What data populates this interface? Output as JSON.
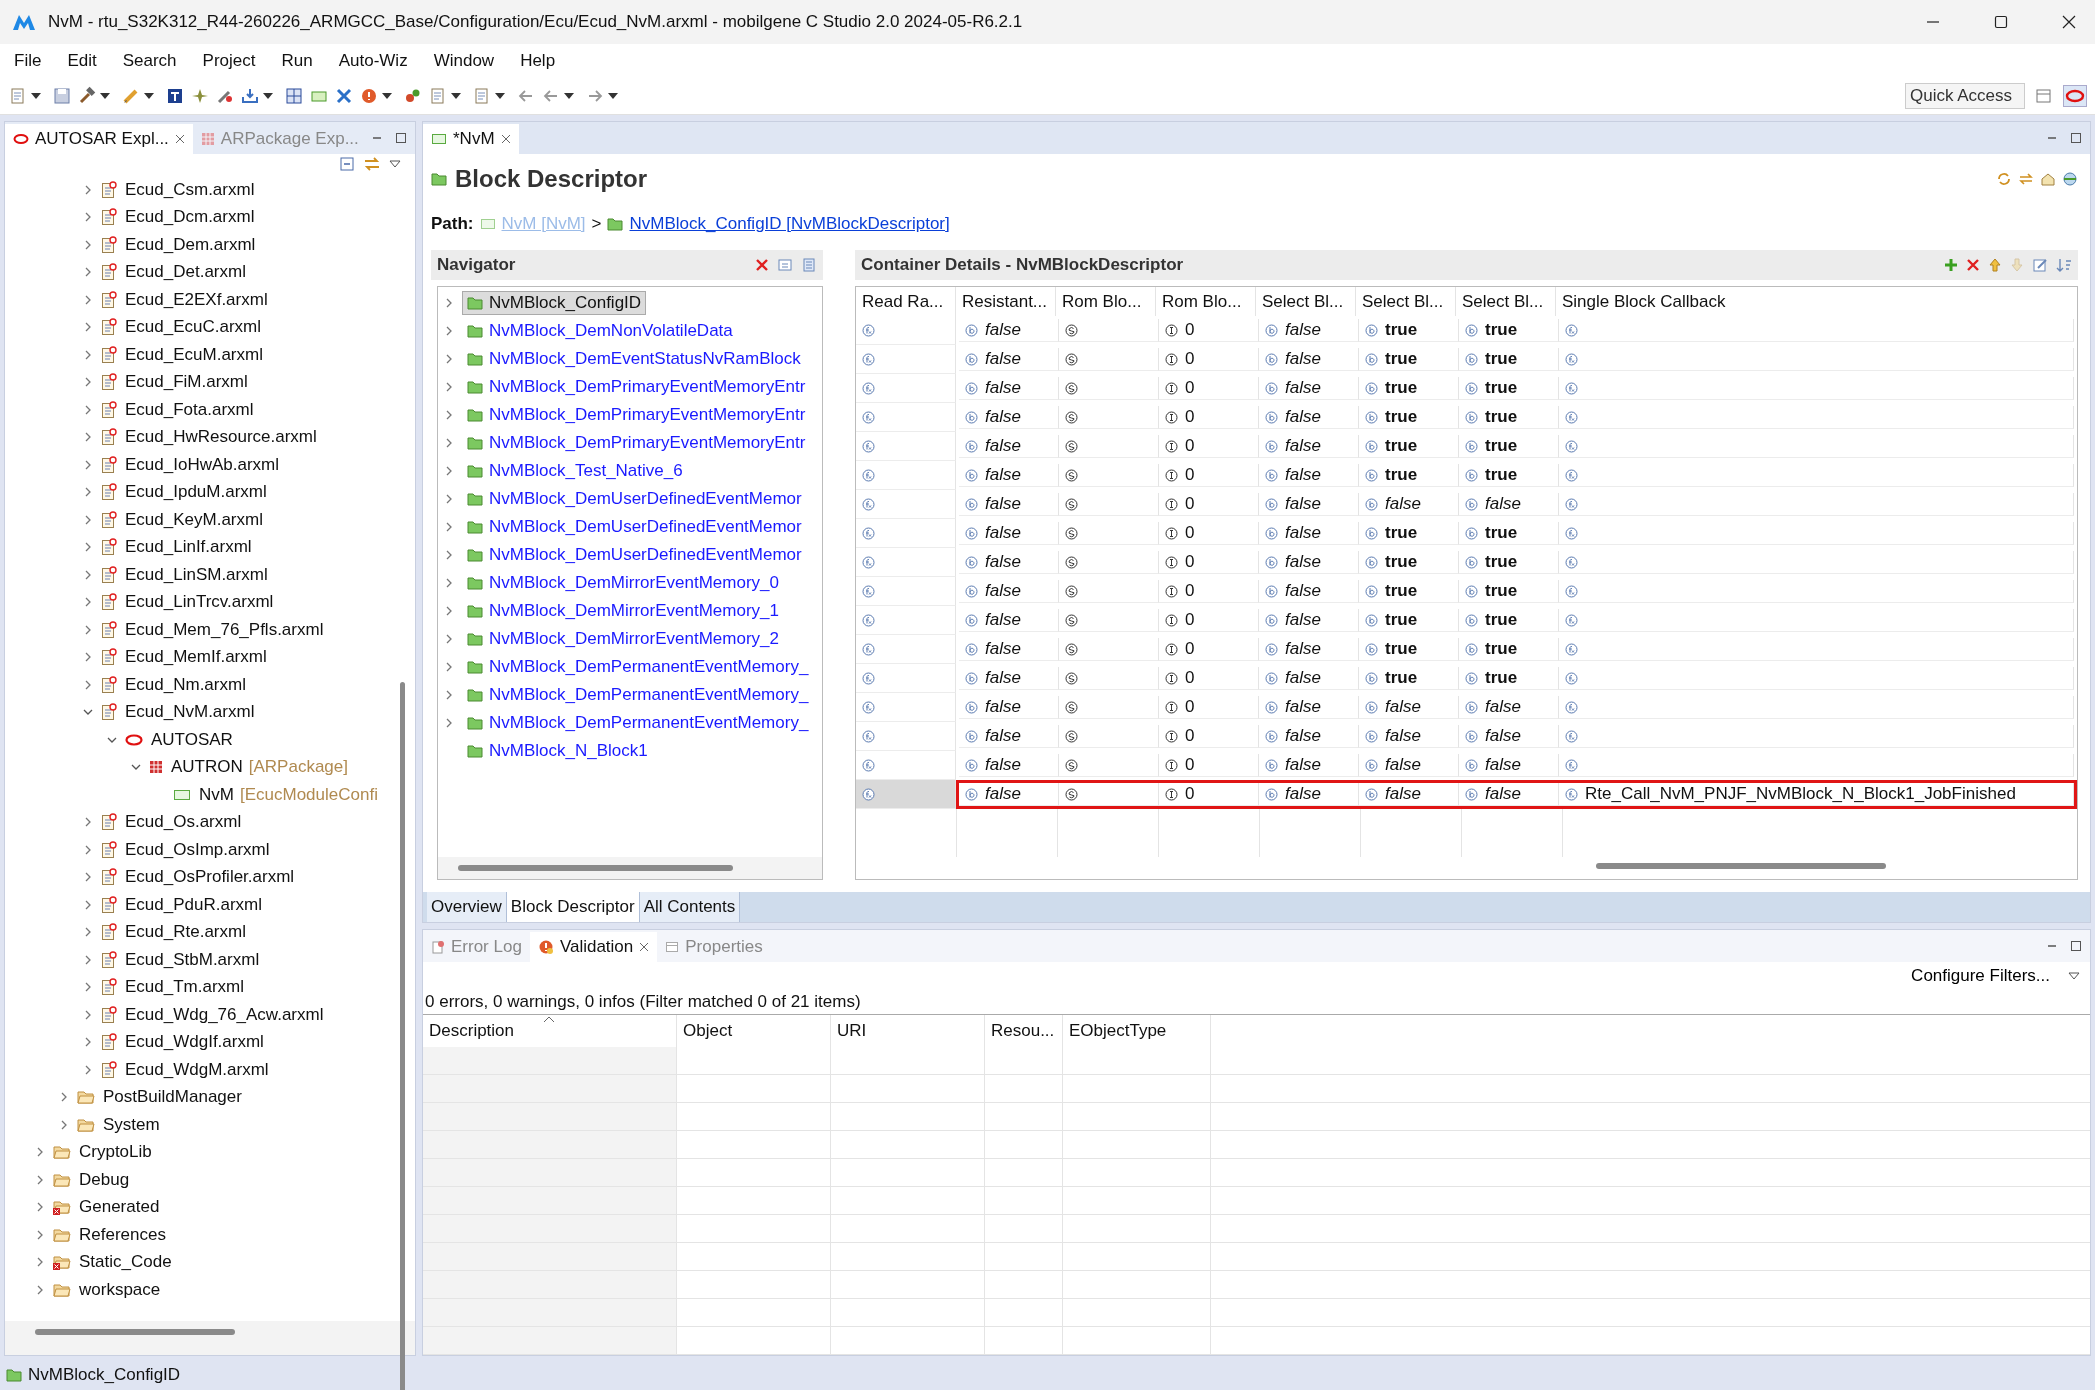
{
  "window": {
    "title": "NvM - rtu_S32K312_R44-260226_ARMGCC_Base/Configuration/Ecu/Ecud_NvM.arxml - mobilgene C Studio 2.0 2024-05-R6.2.1"
  },
  "menu": [
    "File",
    "Edit",
    "Search",
    "Project",
    "Run",
    "Auto-Wiz",
    "Window",
    "Help"
  ],
  "quick_access": {
    "placeholder": "Quick Access"
  },
  "explorer": {
    "tabs": [
      {
        "label": "AUTOSAR Expl...",
        "selected": true
      },
      {
        "label": "ARPackage Exp...",
        "selected": false
      }
    ],
    "tree": [
      {
        "children": [
          {
            "children": [
              {
                "label": "Ecud_Csm.arxml",
                "kind": "file",
                "expanded": false
              },
              {
                "label": "Ecud_Dcm.arxml",
                "kind": "file",
                "expanded": false
              },
              {
                "label": "Ecud_Dem.arxml",
                "kind": "file",
                "expanded": false
              },
              {
                "label": "Ecud_Det.arxml",
                "kind": "file",
                "expanded": false
              },
              {
                "label": "Ecud_E2EXf.arxml",
                "kind": "file",
                "expanded": false
              },
              {
                "label": "Ecud_EcuC.arxml",
                "kind": "file",
                "expanded": false
              },
              {
                "label": "Ecud_EcuM.arxml",
                "kind": "file",
                "expanded": false
              },
              {
                "label": "Ecud_FiM.arxml",
                "kind": "file",
                "expanded": false
              },
              {
                "label": "Ecud_Fota.arxml",
                "kind": "file",
                "expanded": false
              },
              {
                "label": "Ecud_HwResource.arxml",
                "kind": "file",
                "expanded": false
              },
              {
                "label": "Ecud_IoHwAb.arxml",
                "kind": "file",
                "expanded": false
              },
              {
                "label": "Ecud_IpduM.arxml",
                "kind": "file",
                "expanded": false
              },
              {
                "label": "Ecud_KeyM.arxml",
                "kind": "file",
                "expanded": false
              },
              {
                "label": "Ecud_LinIf.arxml",
                "kind": "file",
                "expanded": false
              },
              {
                "label": "Ecud_LinSM.arxml",
                "kind": "file",
                "expanded": false
              },
              {
                "label": "Ecud_LinTrcv.arxml",
                "kind": "file",
                "expanded": false
              },
              {
                "label": "Ecud_Mem_76_Pfls.arxml",
                "kind": "file",
                "expanded": false
              },
              {
                "label": "Ecud_MemIf.arxml",
                "kind": "file",
                "expanded": false
              },
              {
                "label": "Ecud_Nm.arxml",
                "kind": "file",
                "expanded": false
              },
              {
                "label": "Ecud_NvM.arxml",
                "kind": "file",
                "expanded": true,
                "children": [
                  {
                    "label": "AUTOSAR",
                    "kind": "autosar",
                    "expanded": true,
                    "children": [
                      {
                        "label": "AUTRON",
                        "type": "[ARPackage]",
                        "kind": "package",
                        "expanded": true,
                        "children": [
                          {
                            "label": "NvM",
                            "type": "[EcucModuleConfi",
                            "kind": "module"
                          }
                        ]
                      }
                    ]
                  }
                ]
              },
              {
                "label": "Ecud_Os.arxml",
                "kind": "file",
                "expanded": false
              },
              {
                "label": "Ecud_OsImp.arxml",
                "kind": "file",
                "expanded": false
              },
              {
                "label": "Ecud_OsProfiler.arxml",
                "kind": "file",
                "expanded": false
              },
              {
                "label": "Ecud_PduR.arxml",
                "kind": "file",
                "expanded": false
              },
              {
                "label": "Ecud_Rte.arxml",
                "kind": "file",
                "expanded": false
              },
              {
                "label": "Ecud_StbM.arxml",
                "kind": "file",
                "expanded": false
              },
              {
                "label": "Ecud_Tm.arxml",
                "kind": "file",
                "expanded": false
              },
              {
                "label": "Ecud_Wdg_76_Acw.arxml",
                "kind": "file",
                "expanded": false
              },
              {
                "label": "Ecud_WdgIf.arxml",
                "kind": "file",
                "expanded": false
              },
              {
                "label": "Ecud_WdgM.arxml",
                "kind": "file",
                "expanded": false
              }
            ]
          },
          {
            "label": "PostBuildManager",
            "kind": "folder",
            "expanded": false
          },
          {
            "label": "System",
            "kind": "folder",
            "expanded": false
          }
        ]
      },
      {
        "label": "CryptoLib",
        "kind": "folder",
        "expanded": false
      },
      {
        "label": "Debug",
        "kind": "folder",
        "expanded": false
      },
      {
        "label": "Generated",
        "kind": "folder-error",
        "expanded": false
      },
      {
        "label": "References",
        "kind": "folder",
        "expanded": false
      },
      {
        "label": "Static_Code",
        "kind": "folder-error",
        "expanded": false
      },
      {
        "label": "workspace",
        "kind": "folder",
        "expanded": false
      }
    ]
  },
  "editor": {
    "tab": {
      "label": "*NvM",
      "selected": true
    },
    "heading": "Block Descriptor",
    "path": {
      "label": "Path:",
      "parent": "NvM [NvM]",
      "separator": ">",
      "current": "NvMBlock_ConfigID [NvMBlockDescriptor]"
    },
    "navigator": {
      "title": "Navigator",
      "items": [
        {
          "label": "NvMBlock_ConfigID",
          "selected": true,
          "expanded": false
        },
        {
          "label": "NvMBlock_DemNonVolatileData",
          "selected": false,
          "expanded": false
        },
        {
          "label": "NvMBlock_DemEventStatusNvRamBlock",
          "selected": false,
          "expanded": false
        },
        {
          "label": "NvMBlock_DemPrimaryEventMemoryEntr",
          "selected": false,
          "expanded": false
        },
        {
          "label": "NvMBlock_DemPrimaryEventMemoryEntr",
          "selected": false,
          "expanded": false
        },
        {
          "label": "NvMBlock_DemPrimaryEventMemoryEntr",
          "selected": false,
          "expanded": false
        },
        {
          "label": "NvMBlock_Test_Native_6",
          "selected": false,
          "expanded": false
        },
        {
          "label": "NvMBlock_DemUserDefinedEventMemor",
          "selected": false,
          "expanded": false
        },
        {
          "label": "NvMBlock_DemUserDefinedEventMemor",
          "selected": false,
          "expanded": false
        },
        {
          "label": "NvMBlock_DemUserDefinedEventMemor",
          "selected": false,
          "expanded": false
        },
        {
          "label": "NvMBlock_DemMirrorEventMemory_0",
          "selected": false,
          "expanded": false
        },
        {
          "label": "NvMBlock_DemMirrorEventMemory_1",
          "selected": false,
          "expanded": false
        },
        {
          "label": "NvMBlock_DemMirrorEventMemory_2",
          "selected": false,
          "expanded": false
        },
        {
          "label": "NvMBlock_DemPermanentEventMemory_",
          "selected": false,
          "expanded": false
        },
        {
          "label": "NvMBlock_DemPermanentEventMemory_",
          "selected": false,
          "expanded": false
        },
        {
          "label": "NvMBlock_DemPermanentEventMemory_",
          "selected": false,
          "expanded": false
        },
        {
          "label": "NvMBlock_N_Block1",
          "selected": false
        }
      ]
    },
    "details": {
      "title": "Container Details - NvMBlockDescriptor",
      "columns": [
        "Read Ra...",
        "Resistant...",
        "Rom Blo...",
        "Rom Blo...",
        "Select Bl...",
        "Select Bl...",
        "Select Bl...",
        "Single Block Callback"
      ],
      "rows": [
        {
          "selected": false,
          "annotated": false,
          "cells": [
            {
              "kind": "function"
            },
            {
              "kind": "boolean",
              "text": "false",
              "strong": false
            },
            {
              "kind": "string"
            },
            {
              "kind": "integer",
              "text": "0"
            },
            {
              "kind": "boolean",
              "text": "false",
              "strong": false
            },
            {
              "kind": "boolean",
              "text": "true",
              "strong": true
            },
            {
              "kind": "boolean",
              "text": "true",
              "strong": true
            },
            {
              "kind": "function"
            }
          ]
        },
        {
          "selected": false,
          "annotated": false,
          "cells": [
            {
              "kind": "function"
            },
            {
              "kind": "boolean",
              "text": "false",
              "strong": false
            },
            {
              "kind": "string"
            },
            {
              "kind": "integer",
              "text": "0"
            },
            {
              "kind": "boolean",
              "text": "false",
              "strong": false
            },
            {
              "kind": "boolean",
              "text": "true",
              "strong": true
            },
            {
              "kind": "boolean",
              "text": "true",
              "strong": true
            },
            {
              "kind": "function"
            }
          ]
        },
        {
          "selected": false,
          "annotated": false,
          "cells": [
            {
              "kind": "function"
            },
            {
              "kind": "boolean",
              "text": "false",
              "strong": false
            },
            {
              "kind": "string"
            },
            {
              "kind": "integer",
              "text": "0"
            },
            {
              "kind": "boolean",
              "text": "false",
              "strong": false
            },
            {
              "kind": "boolean",
              "text": "true",
              "strong": true
            },
            {
              "kind": "boolean",
              "text": "true",
              "strong": true
            },
            {
              "kind": "function"
            }
          ]
        },
        {
          "selected": false,
          "annotated": false,
          "cells": [
            {
              "kind": "function"
            },
            {
              "kind": "boolean",
              "text": "false",
              "strong": false
            },
            {
              "kind": "string"
            },
            {
              "kind": "integer",
              "text": "0"
            },
            {
              "kind": "boolean",
              "text": "false",
              "strong": false
            },
            {
              "kind": "boolean",
              "text": "true",
              "strong": true
            },
            {
              "kind": "boolean",
              "text": "true",
              "strong": true
            },
            {
              "kind": "function"
            }
          ]
        },
        {
          "selected": false,
          "annotated": false,
          "cells": [
            {
              "kind": "function"
            },
            {
              "kind": "boolean",
              "text": "false",
              "strong": false
            },
            {
              "kind": "string"
            },
            {
              "kind": "integer",
              "text": "0"
            },
            {
              "kind": "boolean",
              "text": "false",
              "strong": false
            },
            {
              "kind": "boolean",
              "text": "true",
              "strong": true
            },
            {
              "kind": "boolean",
              "text": "true",
              "strong": true
            },
            {
              "kind": "function"
            }
          ]
        },
        {
          "selected": false,
          "annotated": false,
          "cells": [
            {
              "kind": "function"
            },
            {
              "kind": "boolean",
              "text": "false",
              "strong": false
            },
            {
              "kind": "string"
            },
            {
              "kind": "integer",
              "text": "0"
            },
            {
              "kind": "boolean",
              "text": "false",
              "strong": false
            },
            {
              "kind": "boolean",
              "text": "true",
              "strong": true
            },
            {
              "kind": "boolean",
              "text": "true",
              "strong": true
            },
            {
              "kind": "function"
            }
          ]
        },
        {
          "selected": false,
          "annotated": false,
          "cells": [
            {
              "kind": "function"
            },
            {
              "kind": "boolean",
              "text": "false",
              "strong": false
            },
            {
              "kind": "string"
            },
            {
              "kind": "integer",
              "text": "0"
            },
            {
              "kind": "boolean",
              "text": "false",
              "strong": false
            },
            {
              "kind": "boolean",
              "text": "false",
              "strong": false
            },
            {
              "kind": "boolean",
              "text": "false",
              "strong": false
            },
            {
              "kind": "function"
            }
          ]
        },
        {
          "selected": false,
          "annotated": false,
          "cells": [
            {
              "kind": "function"
            },
            {
              "kind": "boolean",
              "text": "false",
              "strong": false
            },
            {
              "kind": "string"
            },
            {
              "kind": "integer",
              "text": "0"
            },
            {
              "kind": "boolean",
              "text": "false",
              "strong": false
            },
            {
              "kind": "boolean",
              "text": "true",
              "strong": true
            },
            {
              "kind": "boolean",
              "text": "true",
              "strong": true
            },
            {
              "kind": "function"
            }
          ]
        },
        {
          "selected": false,
          "annotated": false,
          "cells": [
            {
              "kind": "function"
            },
            {
              "kind": "boolean",
              "text": "false",
              "strong": false
            },
            {
              "kind": "string"
            },
            {
              "kind": "integer",
              "text": "0"
            },
            {
              "kind": "boolean",
              "text": "false",
              "strong": false
            },
            {
              "kind": "boolean",
              "text": "true",
              "strong": true
            },
            {
              "kind": "boolean",
              "text": "true",
              "strong": true
            },
            {
              "kind": "function"
            }
          ]
        },
        {
          "selected": false,
          "annotated": false,
          "cells": [
            {
              "kind": "function"
            },
            {
              "kind": "boolean",
              "text": "false",
              "strong": false
            },
            {
              "kind": "string"
            },
            {
              "kind": "integer",
              "text": "0"
            },
            {
              "kind": "boolean",
              "text": "false",
              "strong": false
            },
            {
              "kind": "boolean",
              "text": "true",
              "strong": true
            },
            {
              "kind": "boolean",
              "text": "true",
              "strong": true
            },
            {
              "kind": "function"
            }
          ]
        },
        {
          "selected": false,
          "annotated": false,
          "cells": [
            {
              "kind": "function"
            },
            {
              "kind": "boolean",
              "text": "false",
              "strong": false
            },
            {
              "kind": "string"
            },
            {
              "kind": "integer",
              "text": "0"
            },
            {
              "kind": "boolean",
              "text": "false",
              "strong": false
            },
            {
              "kind": "boolean",
              "text": "true",
              "strong": true
            },
            {
              "kind": "boolean",
              "text": "true",
              "strong": true
            },
            {
              "kind": "function"
            }
          ]
        },
        {
          "selected": false,
          "annotated": false,
          "cells": [
            {
              "kind": "function"
            },
            {
              "kind": "boolean",
              "text": "false",
              "strong": false
            },
            {
              "kind": "string"
            },
            {
              "kind": "integer",
              "text": "0"
            },
            {
              "kind": "boolean",
              "text": "false",
              "strong": false
            },
            {
              "kind": "boolean",
              "text": "true",
              "strong": true
            },
            {
              "kind": "boolean",
              "text": "true",
              "strong": true
            },
            {
              "kind": "function"
            }
          ]
        },
        {
          "selected": false,
          "annotated": false,
          "cells": [
            {
              "kind": "function"
            },
            {
              "kind": "boolean",
              "text": "false",
              "strong": false
            },
            {
              "kind": "string"
            },
            {
              "kind": "integer",
              "text": "0"
            },
            {
              "kind": "boolean",
              "text": "false",
              "strong": false
            },
            {
              "kind": "boolean",
              "text": "true",
              "strong": true
            },
            {
              "kind": "boolean",
              "text": "true",
              "strong": true
            },
            {
              "kind": "function"
            }
          ]
        },
        {
          "selected": false,
          "annotated": false,
          "cells": [
            {
              "kind": "function"
            },
            {
              "kind": "boolean",
              "text": "false",
              "strong": false
            },
            {
              "kind": "string"
            },
            {
              "kind": "integer",
              "text": "0"
            },
            {
              "kind": "boolean",
              "text": "false",
              "strong": false
            },
            {
              "kind": "boolean",
              "text": "false",
              "strong": false
            },
            {
              "kind": "boolean",
              "text": "false",
              "strong": false
            },
            {
              "kind": "function"
            }
          ]
        },
        {
          "selected": false,
          "annotated": false,
          "cells": [
            {
              "kind": "function"
            },
            {
              "kind": "boolean",
              "text": "false",
              "strong": false
            },
            {
              "kind": "string"
            },
            {
              "kind": "integer",
              "text": "0"
            },
            {
              "kind": "boolean",
              "text": "false",
              "strong": false
            },
            {
              "kind": "boolean",
              "text": "false",
              "strong": false
            },
            {
              "kind": "boolean",
              "text": "false",
              "strong": false
            },
            {
              "kind": "function"
            }
          ]
        },
        {
          "selected": false,
          "annotated": false,
          "cells": [
            {
              "kind": "function"
            },
            {
              "kind": "boolean",
              "text": "false",
              "strong": false
            },
            {
              "kind": "string"
            },
            {
              "kind": "integer",
              "text": "0"
            },
            {
              "kind": "boolean",
              "text": "false",
              "strong": false
            },
            {
              "kind": "boolean",
              "text": "false",
              "strong": false
            },
            {
              "kind": "boolean",
              "text": "false",
              "strong": false
            },
            {
              "kind": "function"
            }
          ]
        },
        {
          "selected": true,
          "annotated": true,
          "cells": [
            {
              "kind": "function"
            },
            {
              "kind": "boolean",
              "text": "false",
              "strong": false
            },
            {
              "kind": "string"
            },
            {
              "kind": "integer",
              "text": "0"
            },
            {
              "kind": "boolean",
              "text": "false",
              "strong": false
            },
            {
              "kind": "boolean",
              "text": "false",
              "strong": false
            },
            {
              "kind": "boolean",
              "text": "false",
              "strong": false
            },
            {
              "kind": "function",
              "text": "Rte_Call_NvM_PNJF_NvMBlock_N_Block1_JobFinished"
            }
          ]
        }
      ]
    },
    "pages": [
      {
        "label": "Overview",
        "selected": false
      },
      {
        "label": "Block Descriptor",
        "selected": true
      },
      {
        "label": "All Contents",
        "selected": false
      }
    ]
  },
  "bottom": {
    "tabs": [
      {
        "label": "Error Log",
        "selected": false
      },
      {
        "label": "Validation",
        "selected": true
      },
      {
        "label": "Properties",
        "selected": false
      }
    ],
    "configure": "Configure Filters...",
    "summary": "0 errors, 0 warnings, 0 infos (Filter matched 0 of 21 items)",
    "columns": [
      {
        "label": "Description",
        "sorted": true
      },
      {
        "label": "Object",
        "sorted": false
      },
      {
        "label": "URI",
        "sorted": false
      },
      {
        "label": "Resou...",
        "sorted": false
      },
      {
        "label": "EObjectType",
        "sorted": false
      }
    ]
  },
  "status_bar": {
    "text": "NvMBlock_ConfigID"
  }
}
